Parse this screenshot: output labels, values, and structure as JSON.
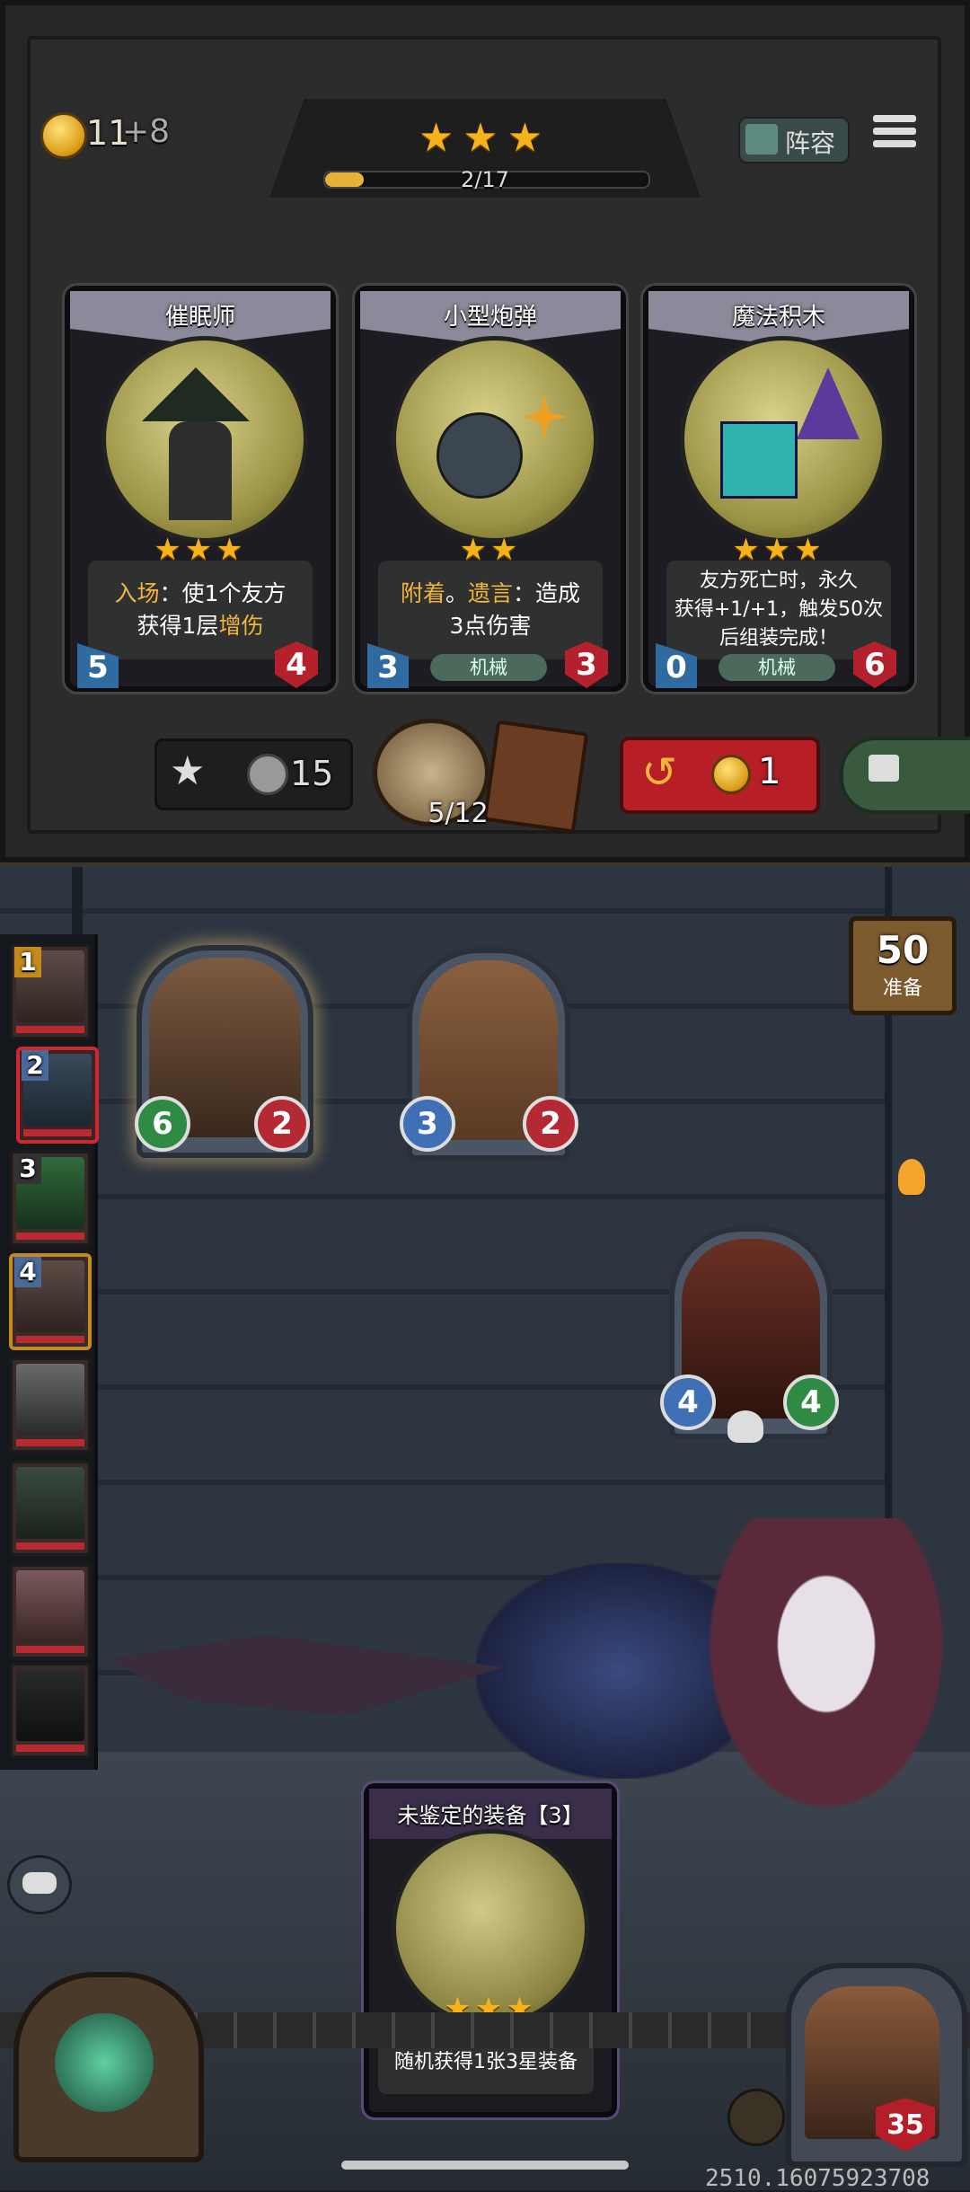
{
  "header": {
    "gold": "11",
    "gold_income": "+8",
    "tier_stars": "★★★",
    "tier_progress_text": "2/17",
    "tier_progress": 0.12,
    "lineup_label": "阵容"
  },
  "cards": [
    {
      "title": "催眠师",
      "stars": "★★★",
      "desc_parts": [
        "入场",
        "：使1个友方",
        "获得1层",
        "增伤"
      ],
      "tag": "",
      "attack": "5",
      "health": "4"
    },
    {
      "title": "小型炮弹",
      "stars": "★★",
      "desc_parts": [
        "附着",
        "。",
        "遗言",
        "：造成",
        "3点伤害"
      ],
      "tag": "机械",
      "attack": "3",
      "health": "3"
    },
    {
      "title": "魔法积木",
      "stars": "★★★",
      "desc_lines": [
        "友方死亡时，永久",
        "获得+1/+1，触发50次",
        "后组装完成！"
      ],
      "tag": "机械",
      "attack": "0",
      "health": "6"
    }
  ],
  "shop_bar": {
    "upgrade_cost": "15",
    "deck_count": "5/12",
    "refresh_cost": "1"
  },
  "ready": {
    "count": "50",
    "label": "准备"
  },
  "roster": [
    {
      "num": "1"
    },
    {
      "num": "2"
    },
    {
      "num": "3"
    },
    {
      "num": "4"
    },
    {
      "num": ""
    },
    {
      "num": ""
    },
    {
      "num": ""
    },
    {
      "num": ""
    }
  ],
  "board_units": [
    {
      "name": "blacksmith",
      "attack": "6",
      "health": "2"
    },
    {
      "name": "otter",
      "attack": "3",
      "health": "2"
    },
    {
      "name": "brute",
      "attack": "4",
      "health": "4"
    }
  ],
  "equip_card": {
    "title": "未鉴定的装备【3】",
    "stars": "★★★",
    "desc": "随机获得1张3星装备"
  },
  "player": {
    "health": "35"
  },
  "build_id": "2510.16075923708",
  "colors": {
    "gold": "#f5b21b",
    "refresh_red": "#b81e26",
    "attack_blue": "#3f6fb4",
    "health_red": "#b41e28"
  }
}
